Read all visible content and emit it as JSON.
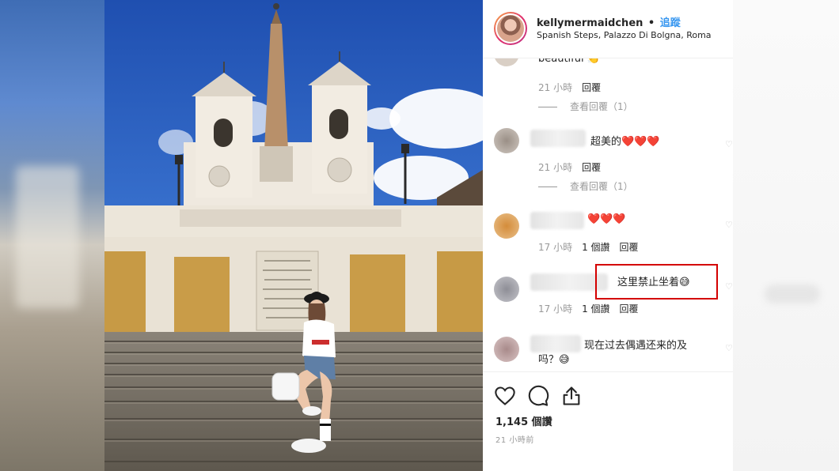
{
  "post": {
    "username": "kellymermaidchen",
    "separator": "•",
    "follow_label": "追蹤",
    "location": "Spanish Steps, Palazzo Di Bolgna, Roma",
    "likes": "1,145 個讚",
    "time_ago": "21 小時前"
  },
  "comments": [
    {
      "text": "beautiful 👏",
      "time": "21 小時",
      "reply": "回覆",
      "view_replies": "查看回覆（1）"
    },
    {
      "text": "超美的❤️❤️❤️",
      "time": "21 小時",
      "reply": "回覆",
      "view_replies": "查看回覆（1）"
    },
    {
      "text": "❤️❤️❤️",
      "time": "17 小時",
      "likes": "1 個讚",
      "reply": "回覆"
    },
    {
      "text": "这里禁止坐着😅",
      "time": "17 小時",
      "likes": "1 個讚",
      "reply": "回覆"
    },
    {
      "text": "现在过去偶遇还来的及",
      "text_line2": "吗？😅"
    }
  ],
  "icons": {
    "like": "heart-icon",
    "comment": "comment-icon",
    "share": "share-icon",
    "next": "chevron-right-icon"
  },
  "colors": {
    "follow": "#3897f0",
    "highlight_box": "#d40000",
    "meta_text": "#999999"
  }
}
